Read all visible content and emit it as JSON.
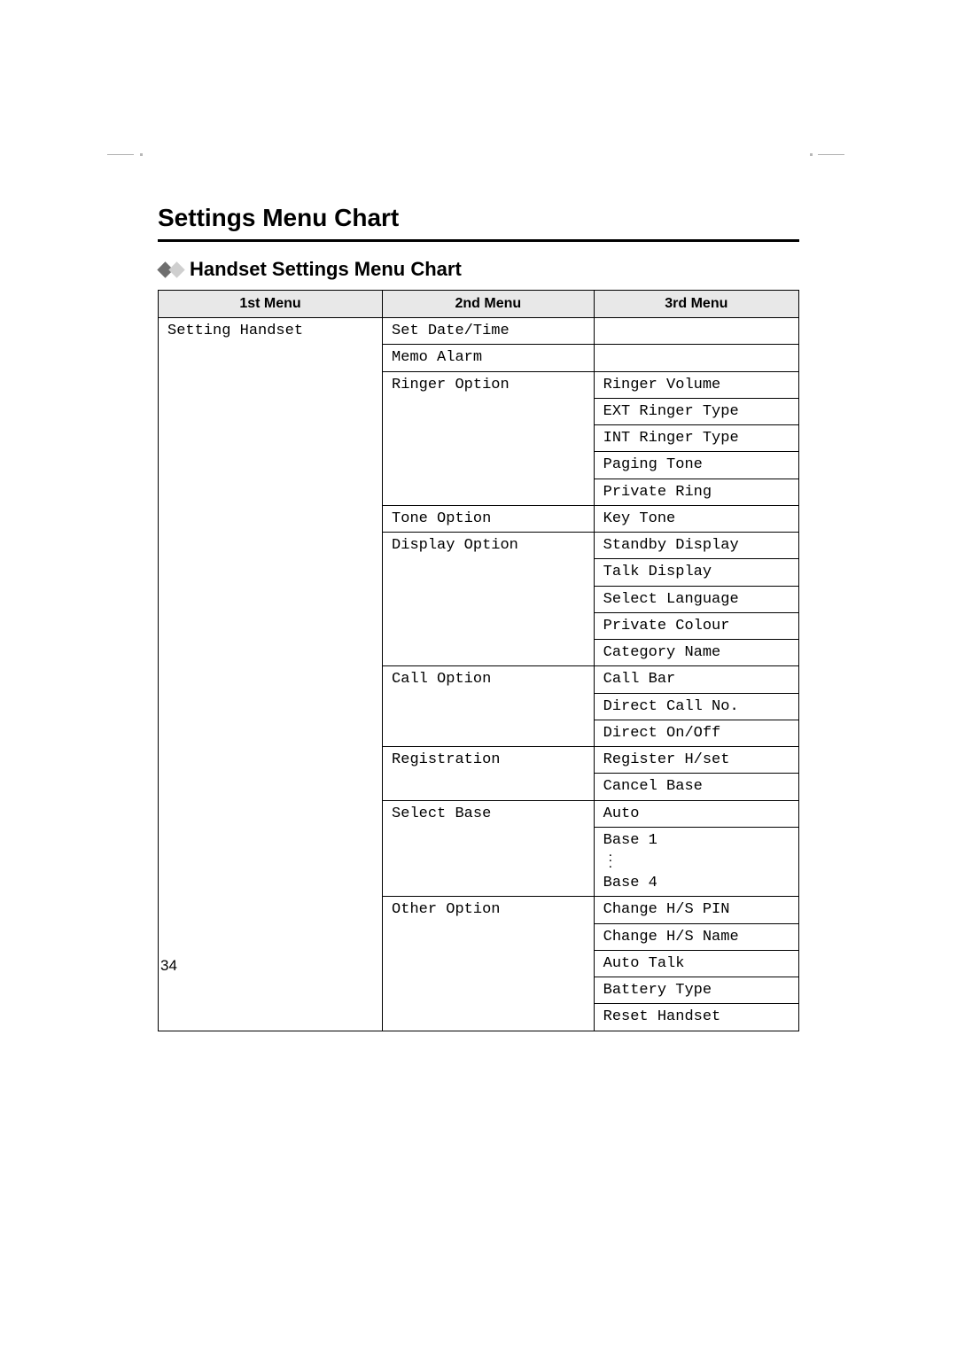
{
  "title": "Settings Menu Chart",
  "subtitle": "Handset Settings Menu Chart",
  "headers": {
    "c1": "1st Menu",
    "c2": "2nd Menu",
    "c3": "3rd Menu"
  },
  "first_menu": "Setting Handset",
  "rows": {
    "m2_set_date": "Set Date/Time",
    "m2_memo_alarm": "Memo Alarm",
    "m2_ringer": "Ringer Option",
    "m3_ringer_vol": "Ringer Volume",
    "m3_ext_ringer": "EXT Ringer Type",
    "m3_int_ringer": "INT Ringer Type",
    "m3_paging": "Paging Tone",
    "m3_private_ring": "Private Ring",
    "m2_tone": "Tone Option",
    "m3_key_tone": "Key Tone",
    "m2_display": "Display Option",
    "m3_standby": "Standby Display",
    "m3_talk": "Talk Display",
    "m3_lang": "Select Language",
    "m3_private_col": "Private Colour",
    "m3_category": "Category Name",
    "m2_call": "Call Option",
    "m3_call_bar": "Call Bar",
    "m3_direct_no": "Direct Call No.",
    "m3_direct_onoff": "Direct On/Off",
    "m2_registration": "Registration",
    "m3_register_hset": "Register H/set",
    "m3_cancel_base": "Cancel Base",
    "m2_select_base": "Select Base",
    "m3_auto": "Auto",
    "m3_base1": "Base 1",
    "m3_base4": "Base 4",
    "m2_other": "Other Option",
    "m3_change_pin": "Change H/S PIN",
    "m3_change_name": "Change H/S Name",
    "m3_auto_talk": "Auto Talk",
    "m3_battery": "Battery Type",
    "m3_reset": "Reset Handset"
  },
  "page_number": "34"
}
